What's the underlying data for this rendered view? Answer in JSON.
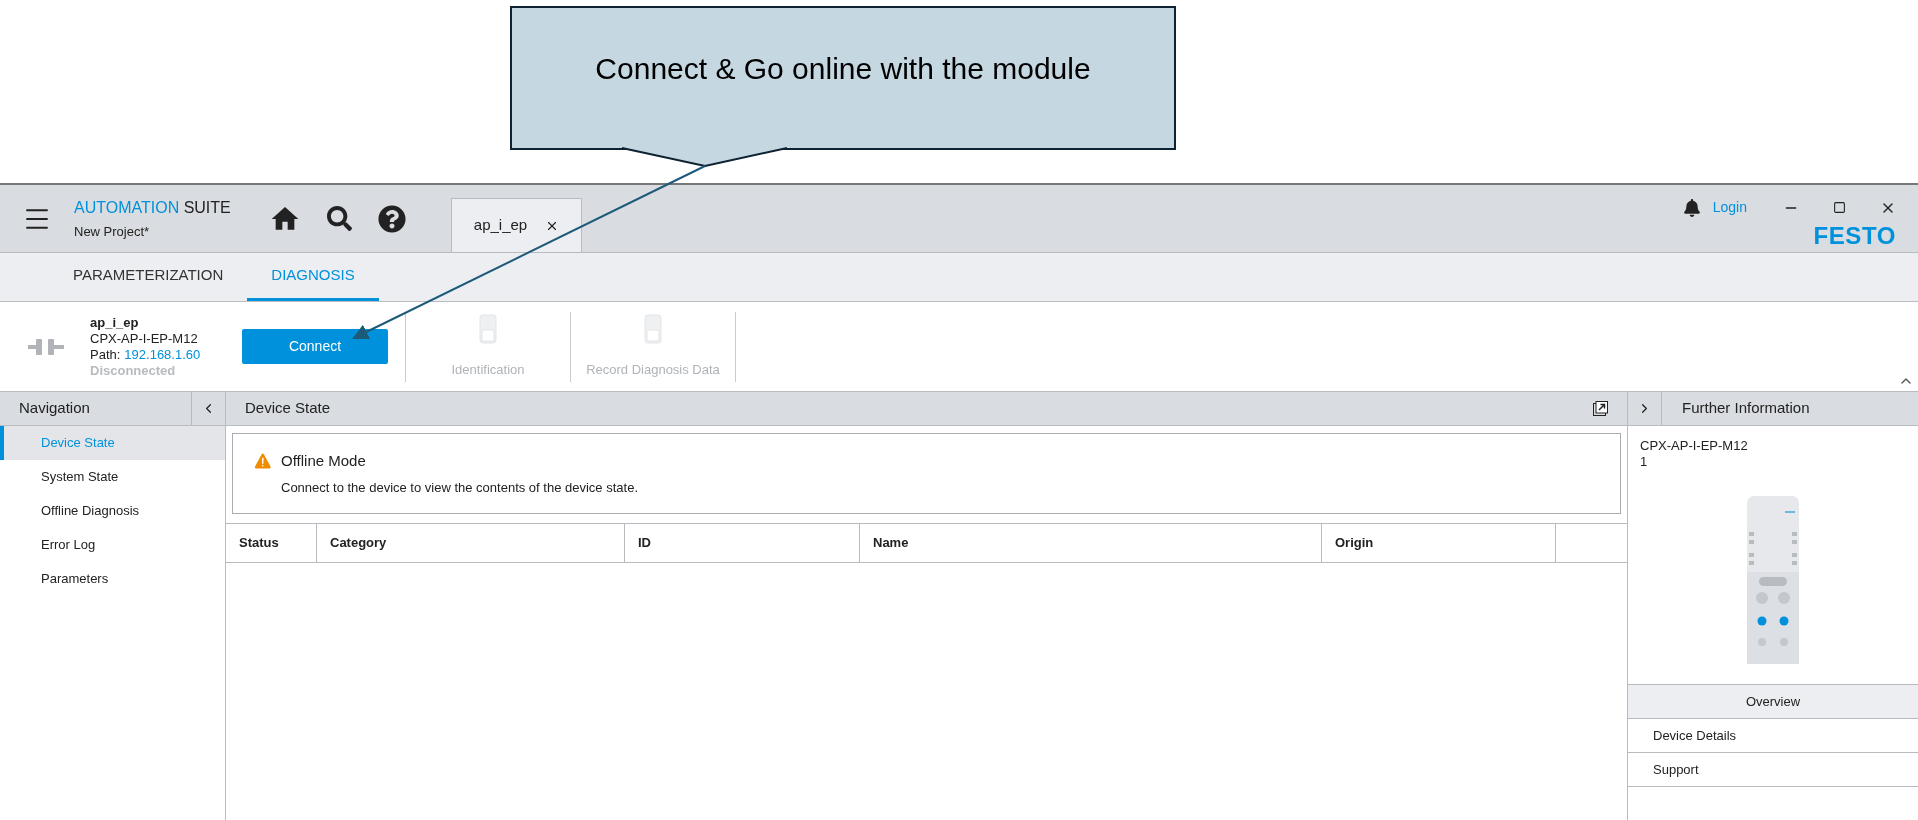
{
  "callout": {
    "text": "Connect & Go online with the module"
  },
  "app": {
    "brand_primary": "AUTOMATION",
    "brand_secondary": "SUITE",
    "project": "New Project*",
    "login": "Login",
    "logo": "FESTO"
  },
  "tabs": [
    {
      "label": "ap_i_ep",
      "selected": true
    }
  ],
  "subtabs": [
    {
      "label": "PARAMETERIZATION",
      "selected": false
    },
    {
      "label": "DIAGNOSIS",
      "selected": true
    }
  ],
  "device": {
    "name": "ap_i_ep",
    "model": "CPX-AP-I-EP-M12",
    "path_label": "Path:",
    "path": "192.168.1.60",
    "status": "Disconnected"
  },
  "connect_button": "Connect",
  "actions": [
    {
      "label": "Identification",
      "disabled": true
    },
    {
      "label": "Record Diagnosis Data",
      "disabled": true
    }
  ],
  "navigation": {
    "title": "Navigation",
    "items": [
      {
        "label": "Device State",
        "selected": true
      },
      {
        "label": "System State",
        "selected": false
      },
      {
        "label": "Offline Diagnosis",
        "selected": false
      },
      {
        "label": "Error Log",
        "selected": false
      },
      {
        "label": "Parameters",
        "selected": false
      }
    ]
  },
  "main": {
    "title": "Device State",
    "notice": {
      "title": "Offline Mode",
      "message": "Connect to the device to view the contents of the device state."
    },
    "table": {
      "columns": [
        "Status",
        "Category",
        "ID",
        "Name",
        "Origin"
      ]
    }
  },
  "info": {
    "title": "Further Information",
    "model": "CPX-AP-I-EP-M12",
    "slot": "1",
    "links": [
      {
        "label": "Overview",
        "selected": true
      },
      {
        "label": "Device Details",
        "selected": false
      },
      {
        "label": "Support",
        "selected": false
      }
    ]
  }
}
